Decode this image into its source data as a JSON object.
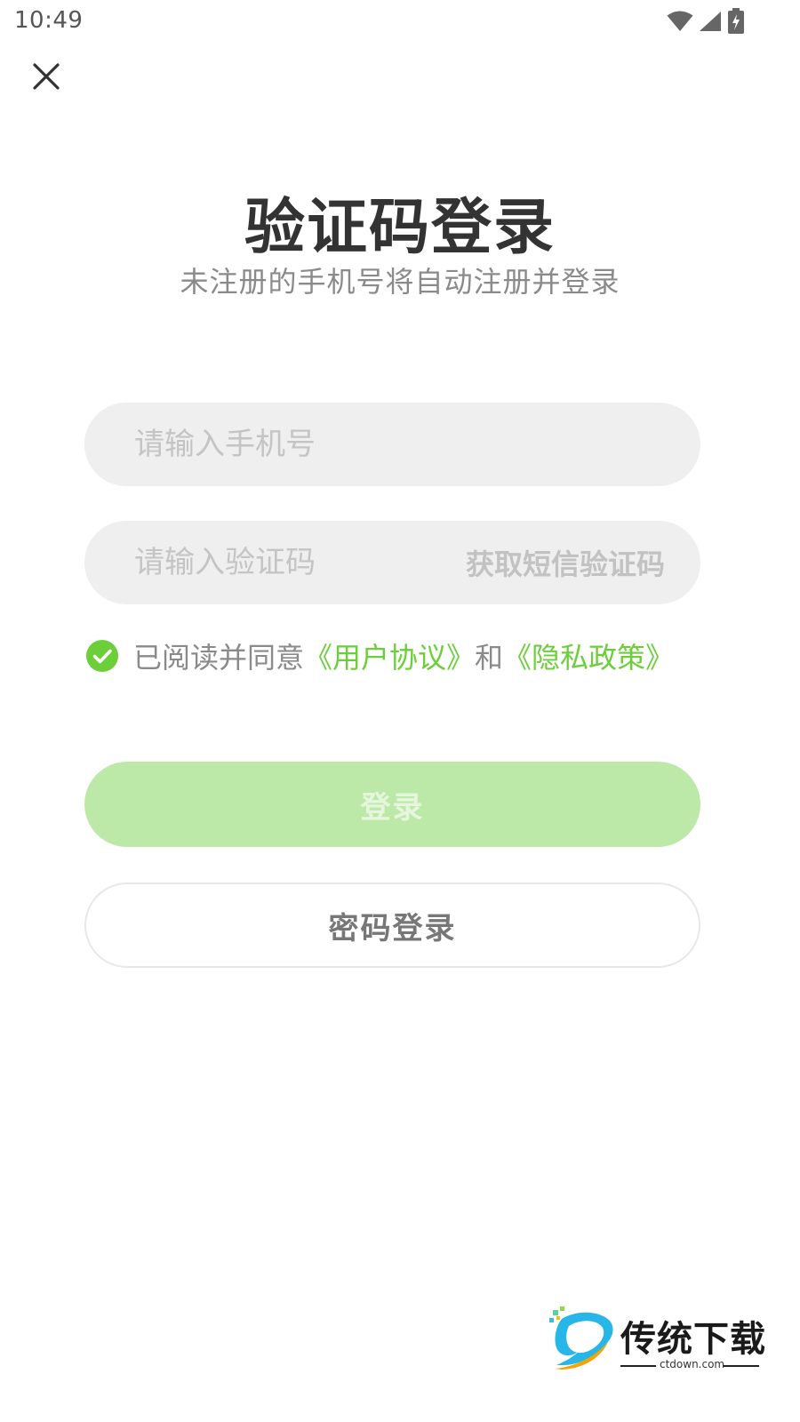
{
  "status_bar": {
    "time": "10:49",
    "icons": [
      "wifi-icon",
      "cell-signal-icon",
      "battery-charging-icon"
    ]
  },
  "header": {
    "close_icon": "close-icon"
  },
  "main": {
    "title": "验证码登录",
    "subtitle": "未注册的手机号将自动注册并登录",
    "phone_input": {
      "value": "",
      "placeholder": "请输入手机号"
    },
    "code_input": {
      "value": "",
      "placeholder": "请输入验证码"
    },
    "get_code_label": "获取短信验证码",
    "agreement": {
      "checked": true,
      "prefix": "已阅读并同意",
      "user_agreement": "《用户协议》",
      "and": "和",
      "privacy_policy": "《隐私政策》"
    },
    "login_label": "登录",
    "password_login_label": "密码登录"
  },
  "watermark": {
    "name": "传统下载",
    "domain": "ctdown.com"
  },
  "colors": {
    "accent": "#6ccf3a",
    "login_button_bg": "#bde9a8",
    "input_bg": "#efefef",
    "placeholder": "#c4c4c4",
    "title": "#333333",
    "subtitle": "#8a8a8a"
  }
}
